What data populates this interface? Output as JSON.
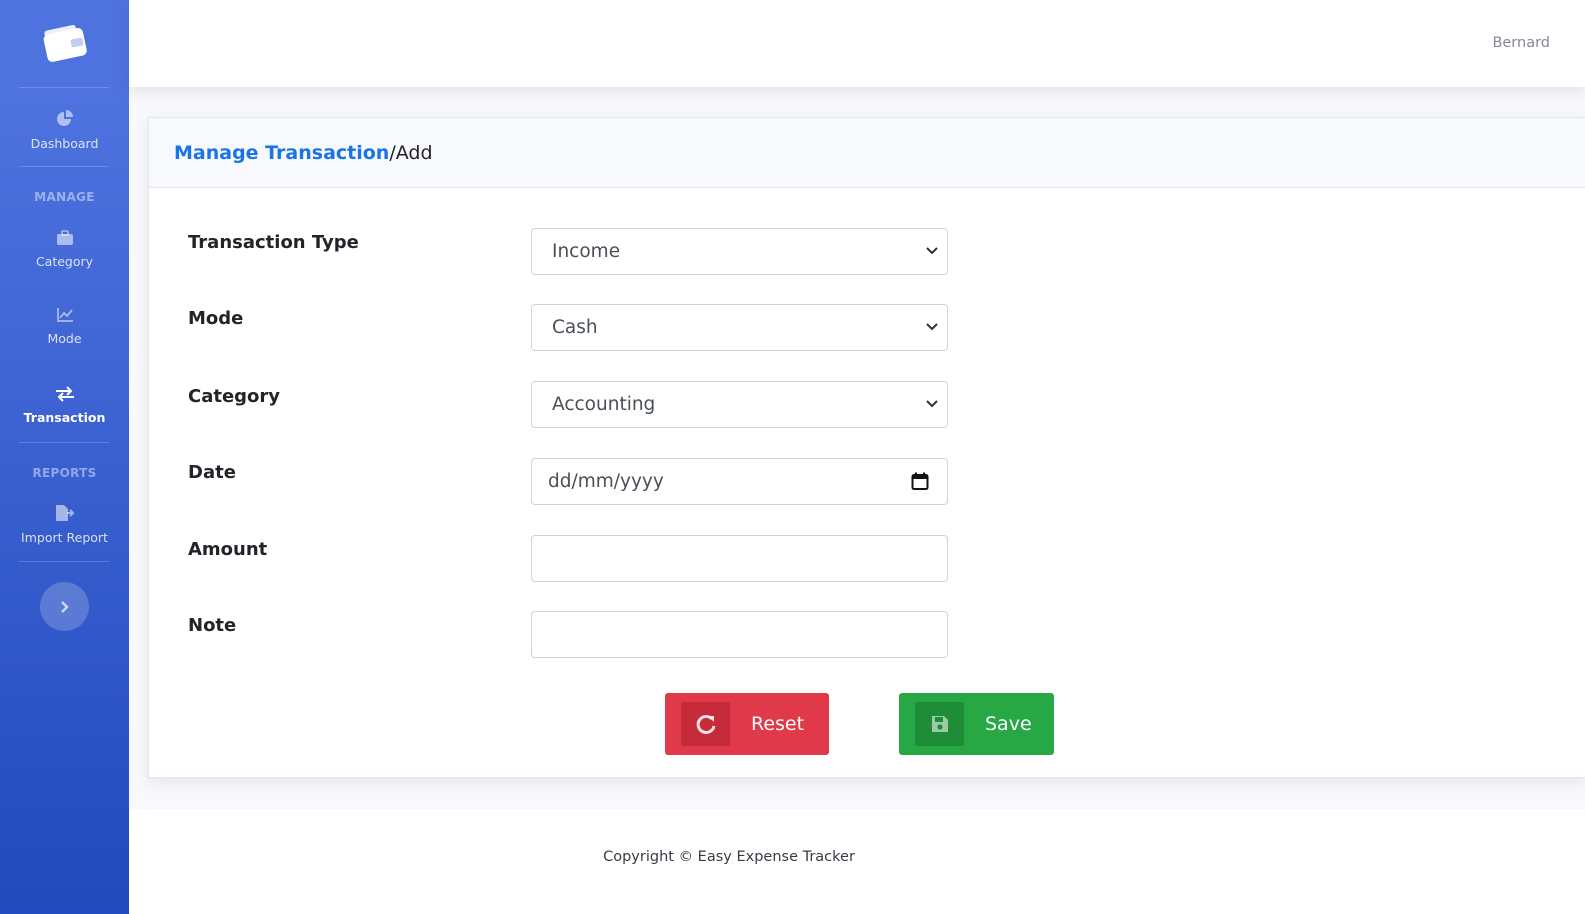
{
  "sidebar": {
    "brand_icon": "wallet-icon",
    "items": [
      {
        "label": "Dashboard",
        "icon": "pie-chart-icon"
      },
      {
        "label": "Category",
        "icon": "briefcase-icon"
      },
      {
        "label": "Mode",
        "icon": "line-chart-icon"
      },
      {
        "label": "Transaction",
        "icon": "exchange-arrows-icon"
      },
      {
        "label": "Import Report",
        "icon": "file-export-icon"
      }
    ],
    "headings": {
      "manage": "MANAGE",
      "reports": "REPORTS"
    }
  },
  "topbar": {
    "user_name": "Bernard"
  },
  "breadcrumb": {
    "link": "Manage Transaction",
    "separator": "/",
    "current": "Add"
  },
  "form": {
    "transaction_type": {
      "label": "Transaction Type",
      "value": "Income"
    },
    "mode": {
      "label": "Mode",
      "value": "Cash"
    },
    "category": {
      "label": "Category",
      "value": "Accounting"
    },
    "date": {
      "label": "Date",
      "placeholder": "dd/mm/yyyy"
    },
    "amount": {
      "label": "Amount",
      "value": ""
    },
    "note": {
      "label": "Note",
      "value": ""
    }
  },
  "buttons": {
    "reset": "Reset",
    "save": "Save"
  },
  "footer": {
    "copyright": "Copyright © Easy Expense Tracker"
  },
  "colors": {
    "sidebar_top": "#4e73df",
    "sidebar_bottom": "#224abe",
    "link": "#1a73e8",
    "reset": "#e0394a",
    "save": "#28a745"
  }
}
